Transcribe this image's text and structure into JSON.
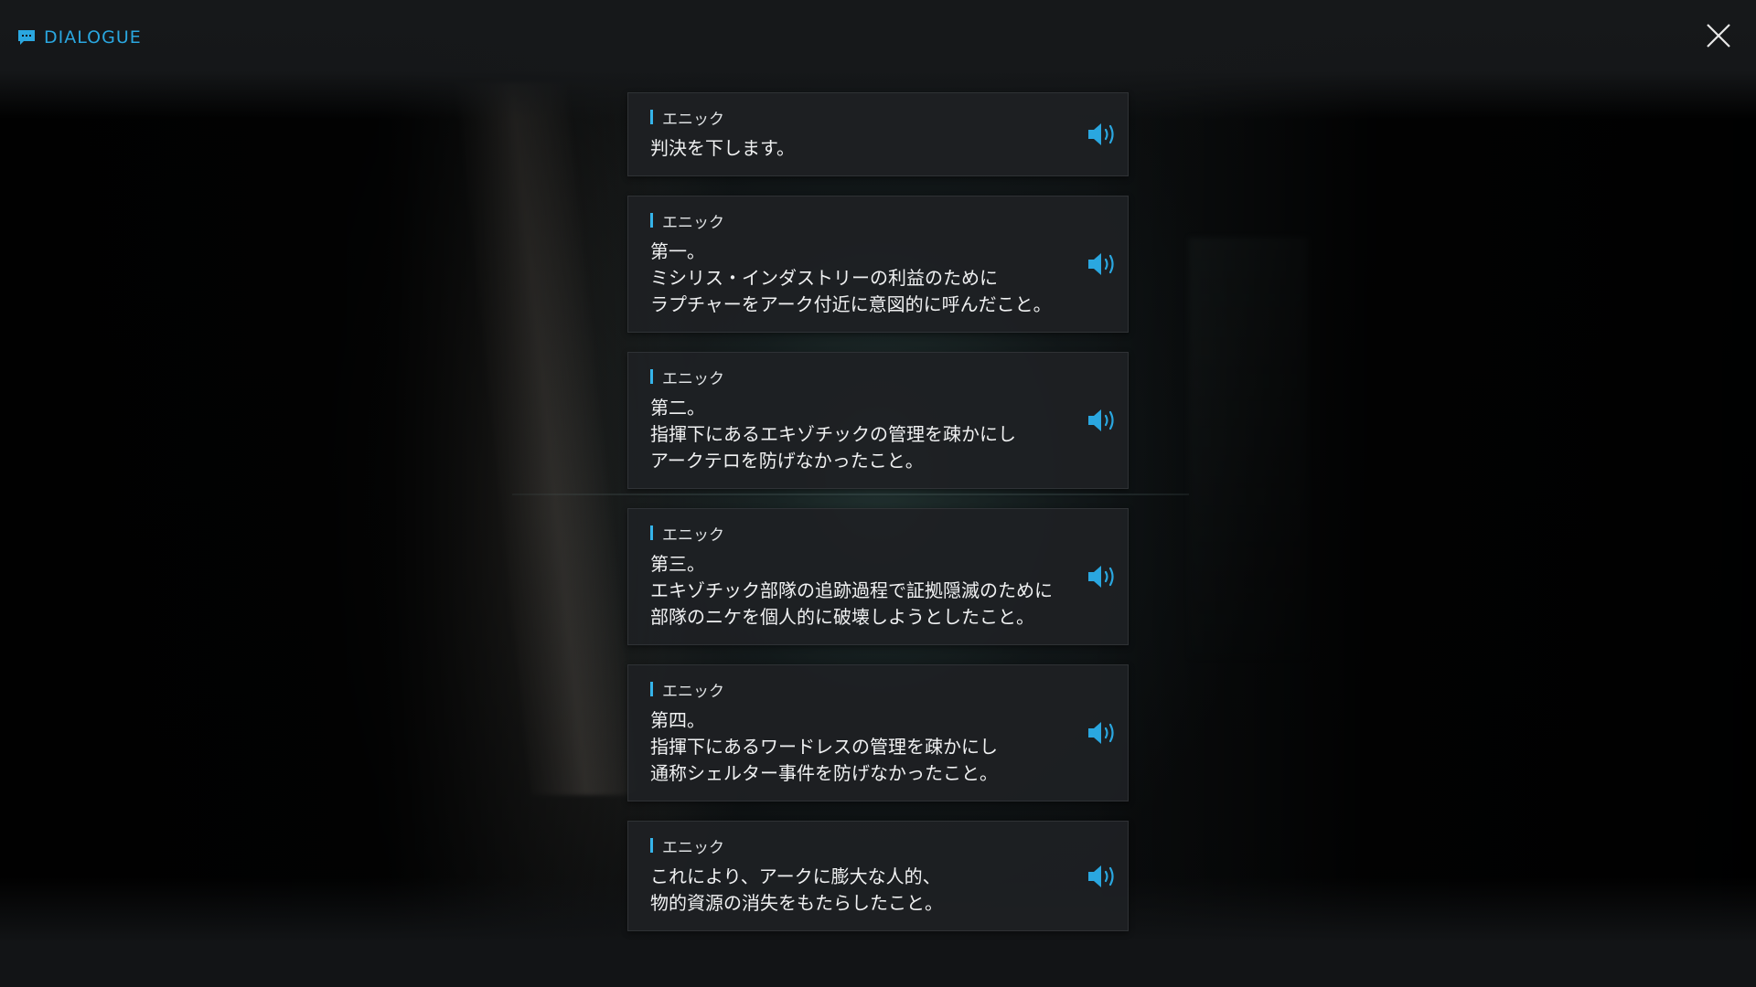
{
  "header": {
    "title": "DIALOGUE",
    "icon": "chat-bubble-icon"
  },
  "close_icon": "close-icon",
  "accent_color": "#2aa7e0",
  "dialogue": [
    {
      "speaker": "エニック",
      "text": "判決を下します。"
    },
    {
      "speaker": "エニック",
      "text": "第一。\nミシリス・インダストリーの利益のために\nラプチャーをアーク付近に意図的に呼んだこと。"
    },
    {
      "speaker": "エニック",
      "text": "第二。\n指揮下にあるエキゾチックの管理を疎かにし\nアークテロを防げなかったこと。"
    },
    {
      "speaker": "エニック",
      "text": "第三。\nエキゾチック部隊の追跡過程で証拠隠滅のために\n部隊のニケを個人的に破壊しようとしたこと。"
    },
    {
      "speaker": "エニック",
      "text": "第四。\n指揮下にあるワードレスの管理を疎かにし\n通称シェルター事件を防げなかったこと。"
    },
    {
      "speaker": "エニック",
      "text": "これにより、アークに膨大な人的、\n物的資源の消失をもたらしたこと。"
    }
  ],
  "voice_icon": "speaker-volume-icon"
}
